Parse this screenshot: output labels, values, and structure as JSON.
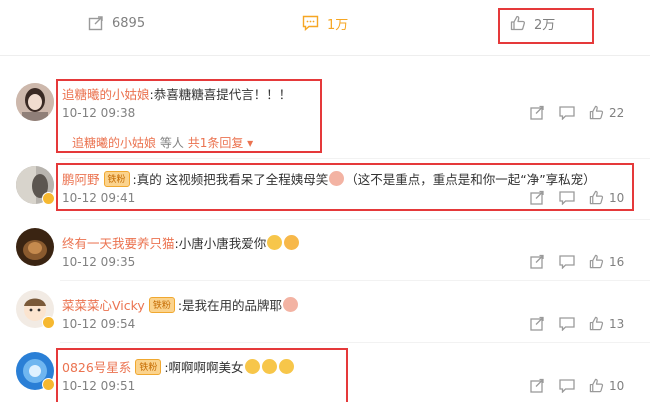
{
  "topbar": {
    "forward_count": "6895",
    "comment_count": "1万",
    "like_count": "2万"
  },
  "comments": [
    {
      "user": "追糖曦的小姑娘",
      "badge": "",
      "text": ":恭喜糖糖喜提代言！！！",
      "time": "10-12 09:38",
      "like_count": "22",
      "reply_user": "追糖曦的小姑娘",
      "reply_suffix": "等人",
      "reply_more": "共1条回复"
    },
    {
      "user": "鹏阿野",
      "badge": "铁粉",
      "text": ":真的 这视频把我看呆了全程姨母笑",
      "text2": "（这不是重点，重点是和你一起“净”享私宠）",
      "time": "10-12 09:41",
      "like_count": "10"
    },
    {
      "user": "终有一天我要养只猫",
      "badge": "",
      "text": ":小唐小唐我爱你",
      "time": "10-12 09:35",
      "like_count": "16"
    },
    {
      "user": "菜菜菜心Vicky",
      "badge": "铁粉",
      "text": ":是我在用的品牌耶",
      "time": "10-12 09:54",
      "like_count": "13"
    },
    {
      "user": "0826号星系",
      "badge": "铁粉",
      "text": ":啊啊啊啊美女",
      "time": "10-12 09:51",
      "like_count": "10"
    }
  ],
  "colors": {
    "accent": "#eb7350",
    "highlight_box": "#e5393a",
    "muted": "#808080",
    "comment_active": "#f6a623"
  },
  "icons": [
    "forward-icon",
    "comment-icon",
    "like-icon",
    "share-icon",
    "reply-icon",
    "emoji-face"
  ]
}
